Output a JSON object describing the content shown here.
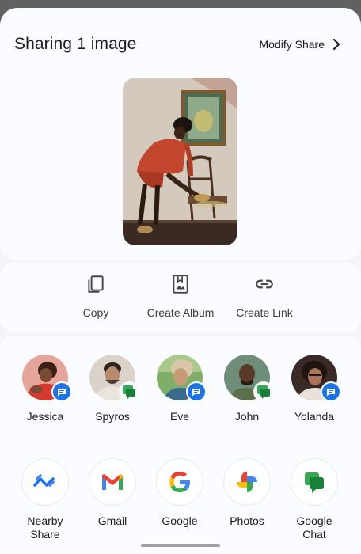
{
  "sheet": {
    "title": "Sharing 1 image",
    "modify_label": "Modify Share",
    "preview_image": "photo-woman-red-dress-chair"
  },
  "actions": [
    {
      "label": "Copy",
      "icon": "copy-icon"
    },
    {
      "label": "Create Album",
      "icon": "album-icon"
    },
    {
      "label": "Create Link",
      "icon": "link-icon"
    }
  ],
  "contacts": [
    {
      "name": "Jessica",
      "badge": "messages-icon"
    },
    {
      "name": "Spyros",
      "badge": "google-chat-icon"
    },
    {
      "name": "Eve",
      "badge": "messages-icon"
    },
    {
      "name": "John",
      "badge": "google-chat-icon"
    },
    {
      "name": "Yolanda",
      "badge": "messages-icon"
    }
  ],
  "apps": [
    {
      "name": "Nearby\nShare",
      "icon": "nearby-share-icon"
    },
    {
      "name": "Gmail",
      "icon": "gmail-icon"
    },
    {
      "name": "Google",
      "icon": "google-icon"
    },
    {
      "name": "Photos",
      "icon": "google-photos-icon"
    },
    {
      "name": "Google\nChat",
      "icon": "google-chat-icon"
    }
  ],
  "colors": {
    "sheet_bg": "#f4f5fa",
    "card_bg": "#fbfcff",
    "messages_blue": "#1a73e8",
    "chat_green": "#34a853"
  }
}
